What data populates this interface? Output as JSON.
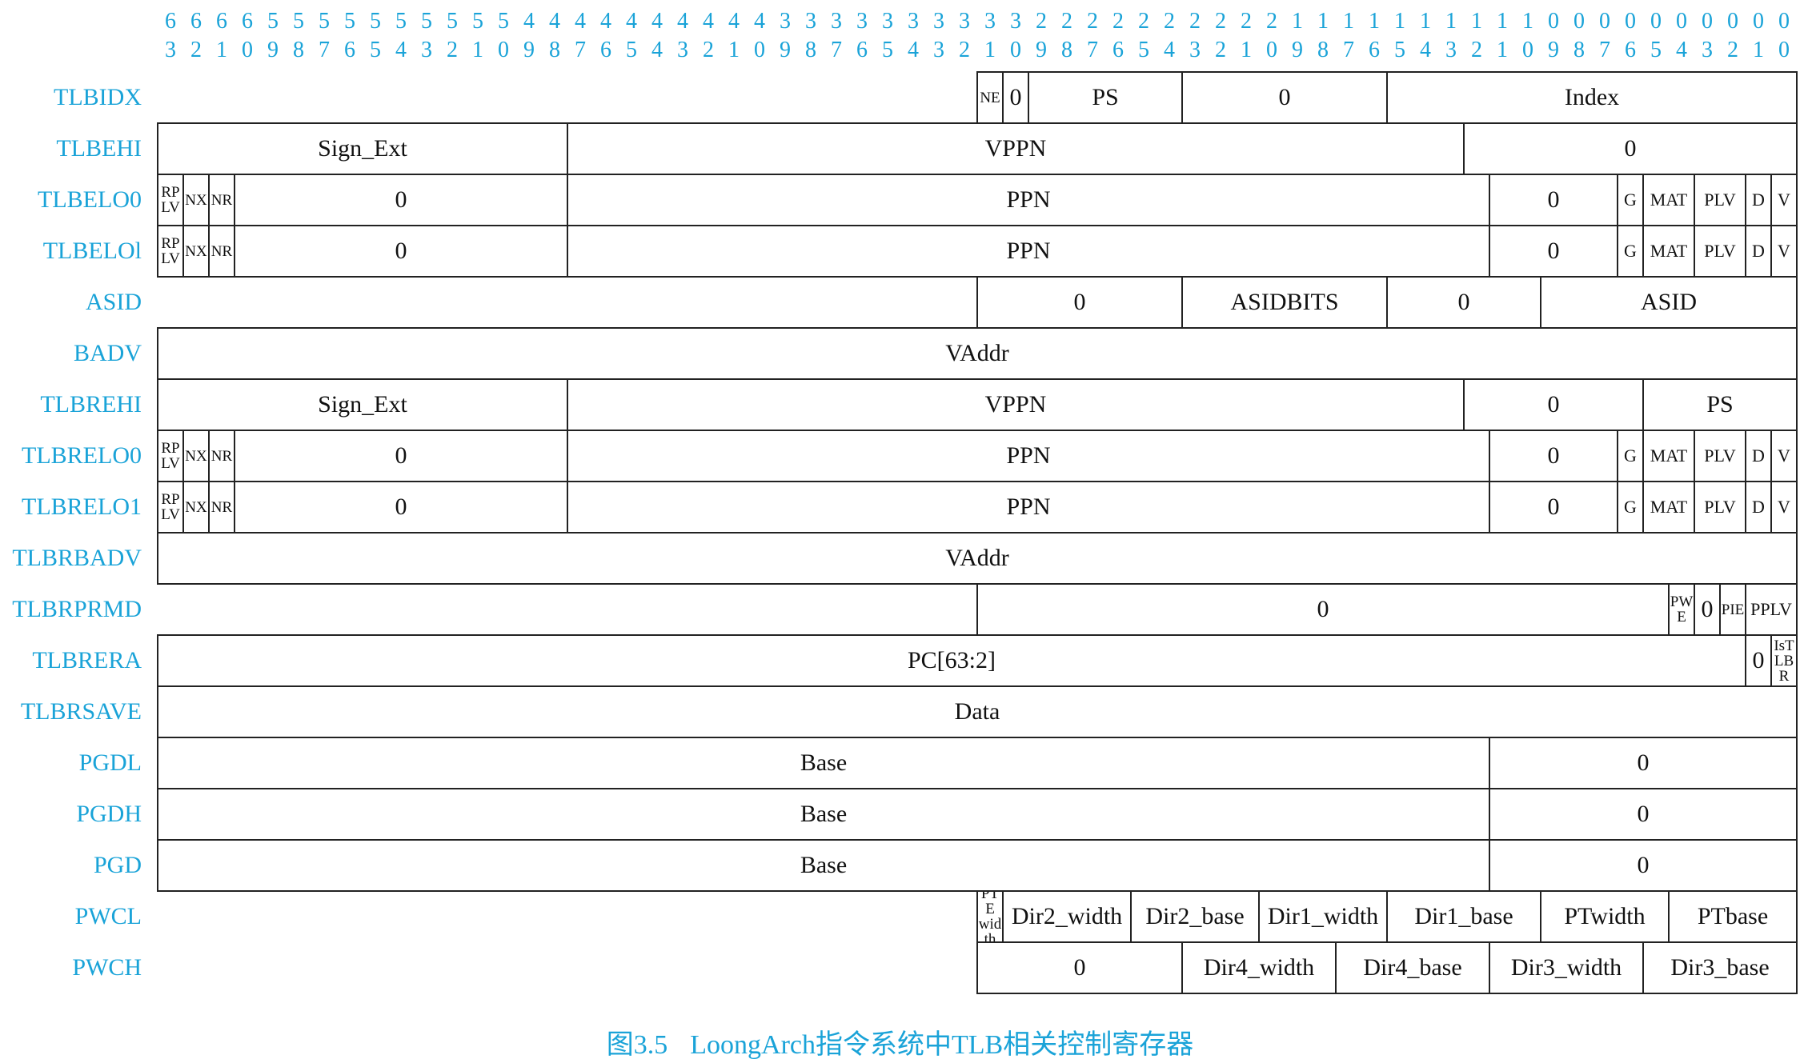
{
  "bit_row_top": [
    "6",
    "6",
    "6",
    "6",
    "5",
    "5",
    "5",
    "5",
    "5",
    "5",
    "5",
    "5",
    "5",
    "5",
    "4",
    "4",
    "4",
    "4",
    "4",
    "4",
    "4",
    "4",
    "4",
    "4",
    "3",
    "3",
    "3",
    "3",
    "3",
    "3",
    "3",
    "3",
    "3",
    "3",
    "2",
    "2",
    "2",
    "2",
    "2",
    "2",
    "2",
    "2",
    "2",
    "2",
    "1",
    "1",
    "1",
    "1",
    "1",
    "1",
    "1",
    "1",
    "1",
    "1",
    "0",
    "0",
    "0",
    "0",
    "0",
    "0",
    "0",
    "0",
    "0",
    "0"
  ],
  "bit_row_bottom": [
    "3",
    "2",
    "1",
    "0",
    "9",
    "8",
    "7",
    "6",
    "5",
    "4",
    "3",
    "2",
    "1",
    "0",
    "9",
    "8",
    "7",
    "6",
    "5",
    "4",
    "3",
    "2",
    "1",
    "0",
    "9",
    "8",
    "7",
    "6",
    "5",
    "4",
    "3",
    "2",
    "1",
    "0",
    "9",
    "8",
    "7",
    "6",
    "5",
    "4",
    "3",
    "2",
    "1",
    "0",
    "9",
    "8",
    "7",
    "6",
    "5",
    "4",
    "3",
    "2",
    "1",
    "0",
    "9",
    "8",
    "7",
    "6",
    "5",
    "4",
    "3",
    "2",
    "1",
    "0"
  ],
  "registers": [
    {
      "name": "TLBIDX",
      "fields": [
        {
          "label": "NE",
          "hi": 31,
          "lo": 31,
          "size": "small"
        },
        {
          "label": "0",
          "hi": 30,
          "lo": 30,
          "size": "large"
        },
        {
          "label": "PS",
          "hi": 29,
          "lo": 24,
          "size": "large"
        },
        {
          "label": "0",
          "hi": 23,
          "lo": 16,
          "size": "large"
        },
        {
          "label": "Index",
          "hi": 15,
          "lo": 0,
          "size": "large"
        }
      ]
    },
    {
      "name": "TLBEHI",
      "fields": [
        {
          "label": "Sign_Ext",
          "hi": 63,
          "lo": 48,
          "size": "large"
        },
        {
          "label": "VPPN",
          "hi": 47,
          "lo": 13,
          "size": "large"
        },
        {
          "label": "0",
          "hi": 12,
          "lo": 0,
          "size": "large"
        }
      ]
    },
    {
      "name": "TLBELO0",
      "fields": [
        {
          "label": "RPLV",
          "hi": 63,
          "lo": 63,
          "size": "small"
        },
        {
          "label": "NX",
          "hi": 62,
          "lo": 62,
          "size": "small"
        },
        {
          "label": "NR",
          "hi": 61,
          "lo": 61,
          "size": "small"
        },
        {
          "label": "0",
          "hi": 60,
          "lo": 48,
          "size": "large"
        },
        {
          "label": "PPN",
          "hi": 47,
          "lo": 12,
          "size": "large"
        },
        {
          "label": "0",
          "hi": 11,
          "lo": 7,
          "size": "large"
        },
        {
          "label": "G",
          "hi": 6,
          "lo": 6,
          "size": "med"
        },
        {
          "label": "MAT",
          "hi": 5,
          "lo": 4,
          "size": "med"
        },
        {
          "label": "PLV",
          "hi": 3,
          "lo": 2,
          "size": "med"
        },
        {
          "label": "D",
          "hi": 1,
          "lo": 1,
          "size": "med"
        },
        {
          "label": "V",
          "hi": 0,
          "lo": 0,
          "size": "med"
        }
      ]
    },
    {
      "name": "TLBELOl",
      "fields": [
        {
          "label": "RPLV",
          "hi": 63,
          "lo": 63,
          "size": "small"
        },
        {
          "label": "NX",
          "hi": 62,
          "lo": 62,
          "size": "small"
        },
        {
          "label": "NR",
          "hi": 61,
          "lo": 61,
          "size": "small"
        },
        {
          "label": "0",
          "hi": 60,
          "lo": 48,
          "size": "large"
        },
        {
          "label": "PPN",
          "hi": 47,
          "lo": 12,
          "size": "large"
        },
        {
          "label": "0",
          "hi": 11,
          "lo": 7,
          "size": "large"
        },
        {
          "label": "G",
          "hi": 6,
          "lo": 6,
          "size": "med"
        },
        {
          "label": "MAT",
          "hi": 5,
          "lo": 4,
          "size": "med"
        },
        {
          "label": "PLV",
          "hi": 3,
          "lo": 2,
          "size": "med"
        },
        {
          "label": "D",
          "hi": 1,
          "lo": 1,
          "size": "med"
        },
        {
          "label": "V",
          "hi": 0,
          "lo": 0,
          "size": "med"
        }
      ]
    },
    {
      "name": "ASID",
      "fields": [
        {
          "label": "0",
          "hi": 31,
          "lo": 24,
          "size": "large"
        },
        {
          "label": "ASIDBITS",
          "hi": 23,
          "lo": 16,
          "size": "large"
        },
        {
          "label": "0",
          "hi": 15,
          "lo": 10,
          "size": "large"
        },
        {
          "label": "ASID",
          "hi": 9,
          "lo": 0,
          "size": "large"
        }
      ]
    },
    {
      "name": "BADV",
      "fields": [
        {
          "label": "VAddr",
          "hi": 63,
          "lo": 0,
          "size": "large"
        }
      ]
    },
    {
      "name": "TLBREHI",
      "fields": [
        {
          "label": "Sign_Ext",
          "hi": 63,
          "lo": 48,
          "size": "large"
        },
        {
          "label": "VPPN",
          "hi": 47,
          "lo": 13,
          "size": "large"
        },
        {
          "label": "0",
          "hi": 12,
          "lo": 6,
          "size": "large"
        },
        {
          "label": "PS",
          "hi": 5,
          "lo": 0,
          "size": "large"
        }
      ]
    },
    {
      "name": "TLBRELO0",
      "fields": [
        {
          "label": "RPLV",
          "hi": 63,
          "lo": 63,
          "size": "small"
        },
        {
          "label": "NX",
          "hi": 62,
          "lo": 62,
          "size": "small"
        },
        {
          "label": "NR",
          "hi": 61,
          "lo": 61,
          "size": "small"
        },
        {
          "label": "0",
          "hi": 60,
          "lo": 48,
          "size": "large"
        },
        {
          "label": "PPN",
          "hi": 47,
          "lo": 12,
          "size": "large"
        },
        {
          "label": "0",
          "hi": 11,
          "lo": 7,
          "size": "large"
        },
        {
          "label": "G",
          "hi": 6,
          "lo": 6,
          "size": "med"
        },
        {
          "label": "MAT",
          "hi": 5,
          "lo": 4,
          "size": "med"
        },
        {
          "label": "PLV",
          "hi": 3,
          "lo": 2,
          "size": "med"
        },
        {
          "label": "D",
          "hi": 1,
          "lo": 1,
          "size": "med"
        },
        {
          "label": "V",
          "hi": 0,
          "lo": 0,
          "size": "med"
        }
      ]
    },
    {
      "name": "TLBRELO1",
      "fields": [
        {
          "label": "RPLV",
          "hi": 63,
          "lo": 63,
          "size": "small"
        },
        {
          "label": "NX",
          "hi": 62,
          "lo": 62,
          "size": "small"
        },
        {
          "label": "NR",
          "hi": 61,
          "lo": 61,
          "size": "small"
        },
        {
          "label": "0",
          "hi": 60,
          "lo": 48,
          "size": "large"
        },
        {
          "label": "PPN",
          "hi": 47,
          "lo": 12,
          "size": "large"
        },
        {
          "label": "0",
          "hi": 11,
          "lo": 7,
          "size": "large"
        },
        {
          "label": "G",
          "hi": 6,
          "lo": 6,
          "size": "med"
        },
        {
          "label": "MAT",
          "hi": 5,
          "lo": 4,
          "size": "med"
        },
        {
          "label": "PLV",
          "hi": 3,
          "lo": 2,
          "size": "med"
        },
        {
          "label": "D",
          "hi": 1,
          "lo": 1,
          "size": "med"
        },
        {
          "label": "V",
          "hi": 0,
          "lo": 0,
          "size": "med"
        }
      ]
    },
    {
      "name": "TLBRBADV",
      "fields": [
        {
          "label": "VAddr",
          "hi": 63,
          "lo": 0,
          "size": "large"
        }
      ]
    },
    {
      "name": "TLBRPRMD",
      "fields": [
        {
          "label": "0",
          "hi": 31,
          "lo": 5,
          "size": "large"
        },
        {
          "label": "PWE",
          "hi": 4,
          "lo": 4,
          "size": "small"
        },
        {
          "label": "0",
          "hi": 3,
          "lo": 3,
          "size": "large"
        },
        {
          "label": "PIE",
          "hi": 2,
          "lo": 2,
          "size": "small"
        },
        {
          "label": "PPLV",
          "hi": 1,
          "lo": 0,
          "size": "med"
        }
      ]
    },
    {
      "name": "TLBRERA",
      "fields": [
        {
          "label": "PC[63:2]",
          "hi": 63,
          "lo": 2,
          "size": "large"
        },
        {
          "label": "0",
          "hi": 1,
          "lo": 1,
          "size": "large"
        },
        {
          "label": "IsTLBR",
          "hi": 0,
          "lo": 0,
          "size": "small"
        }
      ]
    },
    {
      "name": "TLBRSAVE",
      "fields": [
        {
          "label": "Data",
          "hi": 63,
          "lo": 0,
          "size": "large"
        }
      ]
    },
    {
      "name": "PGDL",
      "fields": [
        {
          "label": "Base",
          "hi": 63,
          "lo": 12,
          "size": "large"
        },
        {
          "label": "0",
          "hi": 11,
          "lo": 0,
          "size": "large"
        }
      ]
    },
    {
      "name": "PGDH",
      "fields": [
        {
          "label": "Base",
          "hi": 63,
          "lo": 12,
          "size": "large"
        },
        {
          "label": "0",
          "hi": 11,
          "lo": 0,
          "size": "large"
        }
      ]
    },
    {
      "name": "PGD",
      "fields": [
        {
          "label": "Base",
          "hi": 63,
          "lo": 12,
          "size": "large"
        },
        {
          "label": "0",
          "hi": 11,
          "lo": 0,
          "size": "large"
        }
      ]
    },
    {
      "name": "PWCL",
      "fields": [
        {
          "label": "PTE width",
          "hi": 31,
          "lo": 31,
          "size": "small"
        },
        {
          "label": "Dir2_width",
          "hi": 30,
          "lo": 26,
          "size": "large"
        },
        {
          "label": "Dir2_base",
          "hi": 25,
          "lo": 21,
          "size": "large"
        },
        {
          "label": "Dir1_width",
          "hi": 20,
          "lo": 16,
          "size": "large"
        },
        {
          "label": "Dir1_base",
          "hi": 15,
          "lo": 10,
          "size": "large"
        },
        {
          "label": "PTwidth",
          "hi": 9,
          "lo": 5,
          "size": "large"
        },
        {
          "label": "PTbase",
          "hi": 4,
          "lo": 0,
          "size": "large"
        }
      ]
    },
    {
      "name": "PWCH",
      "fields": [
        {
          "label": "0",
          "hi": 31,
          "lo": 24,
          "size": "large"
        },
        {
          "label": "Dir4_width",
          "hi": 23,
          "lo": 18,
          "size": "large"
        },
        {
          "label": "Dir4_base",
          "hi": 17,
          "lo": 12,
          "size": "large"
        },
        {
          "label": "Dir3_width",
          "hi": 11,
          "lo": 6,
          "size": "large"
        },
        {
          "label": "Dir3_base",
          "hi": 5,
          "lo": 0,
          "size": "large"
        }
      ]
    }
  ],
  "caption": {
    "figure": "图3.5",
    "title": "LoongArch指令系统中TLB相关控制寄存器"
  }
}
